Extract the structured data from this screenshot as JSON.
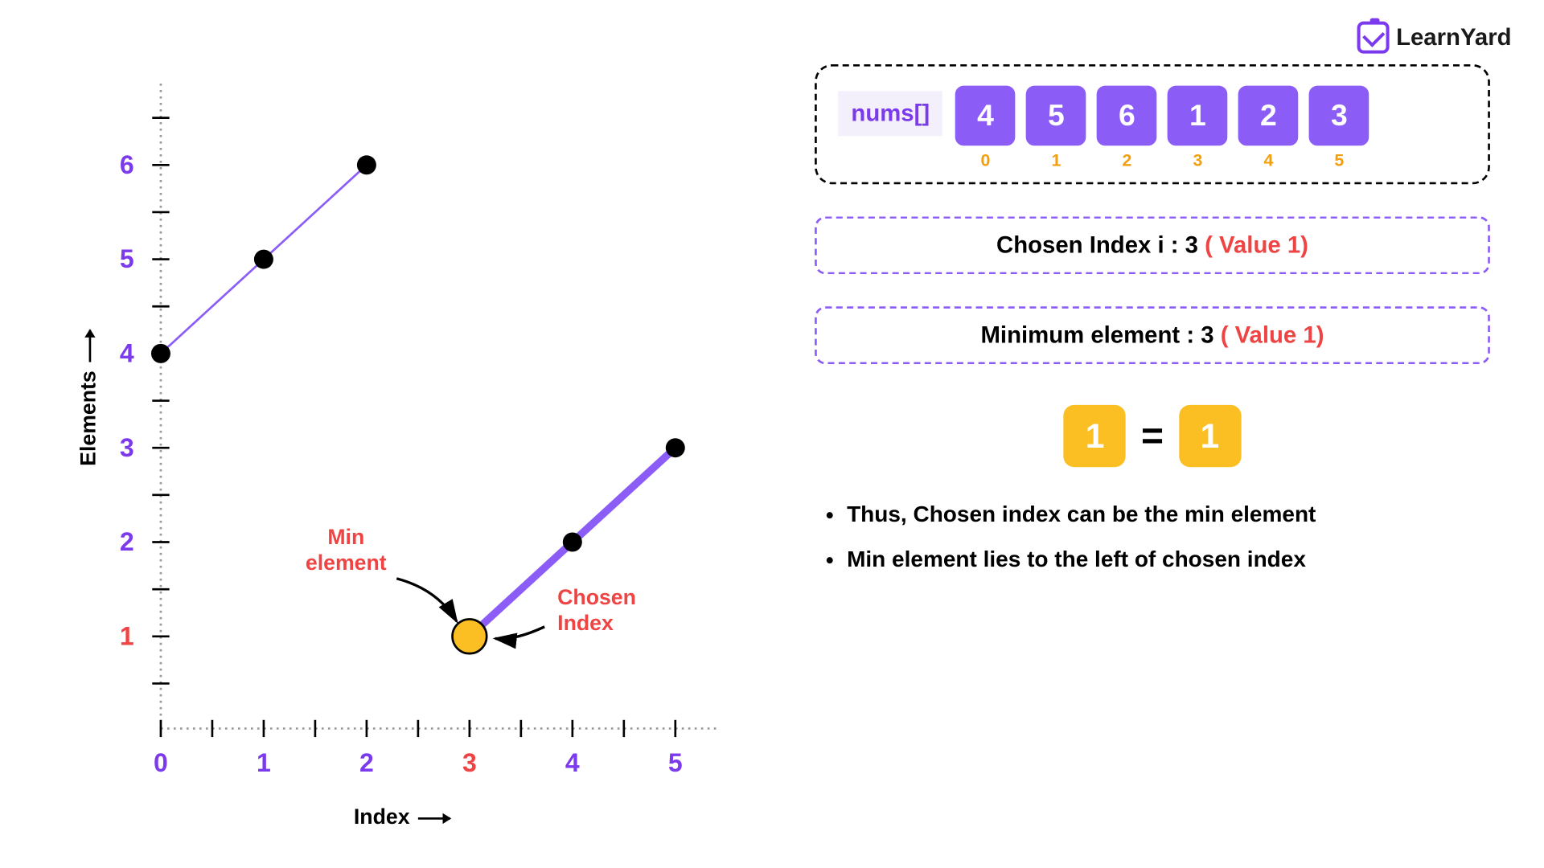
{
  "logo": {
    "text": "LearnYard"
  },
  "chart_data": {
    "type": "line",
    "xlabel": "Index",
    "ylabel": "Elements",
    "x_ticks": [
      0,
      1,
      2,
      3,
      4,
      5
    ],
    "y_ticks": [
      1,
      2,
      3,
      4,
      5,
      6
    ],
    "xlim": [
      0,
      5.5
    ],
    "ylim": [
      0,
      6.3
    ],
    "highlight_x": 3,
    "highlight_y": 1,
    "series": [
      {
        "name": "segment1",
        "x": [
          0,
          1,
          2
        ],
        "y": [
          4,
          5,
          6
        ],
        "thick": false
      },
      {
        "name": "segment2",
        "x": [
          3,
          4,
          5
        ],
        "y": [
          1,
          2,
          3
        ],
        "thick": true
      }
    ],
    "annotations": {
      "min_element": "Min\nelement",
      "chosen_index": "Chosen\nIndex"
    }
  },
  "array": {
    "label": "nums[]",
    "values": [
      4,
      5,
      6,
      1,
      2,
      3
    ],
    "indices": [
      0,
      1,
      2,
      3,
      4,
      5
    ]
  },
  "chosen": {
    "prefix": "Chosen Index i : 3 ",
    "value": "( Value 1)"
  },
  "minimum": {
    "prefix": "Minimum element : 3 ",
    "value": "( Value 1)"
  },
  "equation": {
    "left": "1",
    "sign": "=",
    "right": "1"
  },
  "notes": [
    "Thus, Chosen index can be the min element",
    "Min element lies to the left of chosen index"
  ],
  "labels": {
    "min_element_l1": "Min",
    "min_element_l2": "element",
    "chosen_index_l1": "Chosen",
    "chosen_index_l2": "Index"
  }
}
